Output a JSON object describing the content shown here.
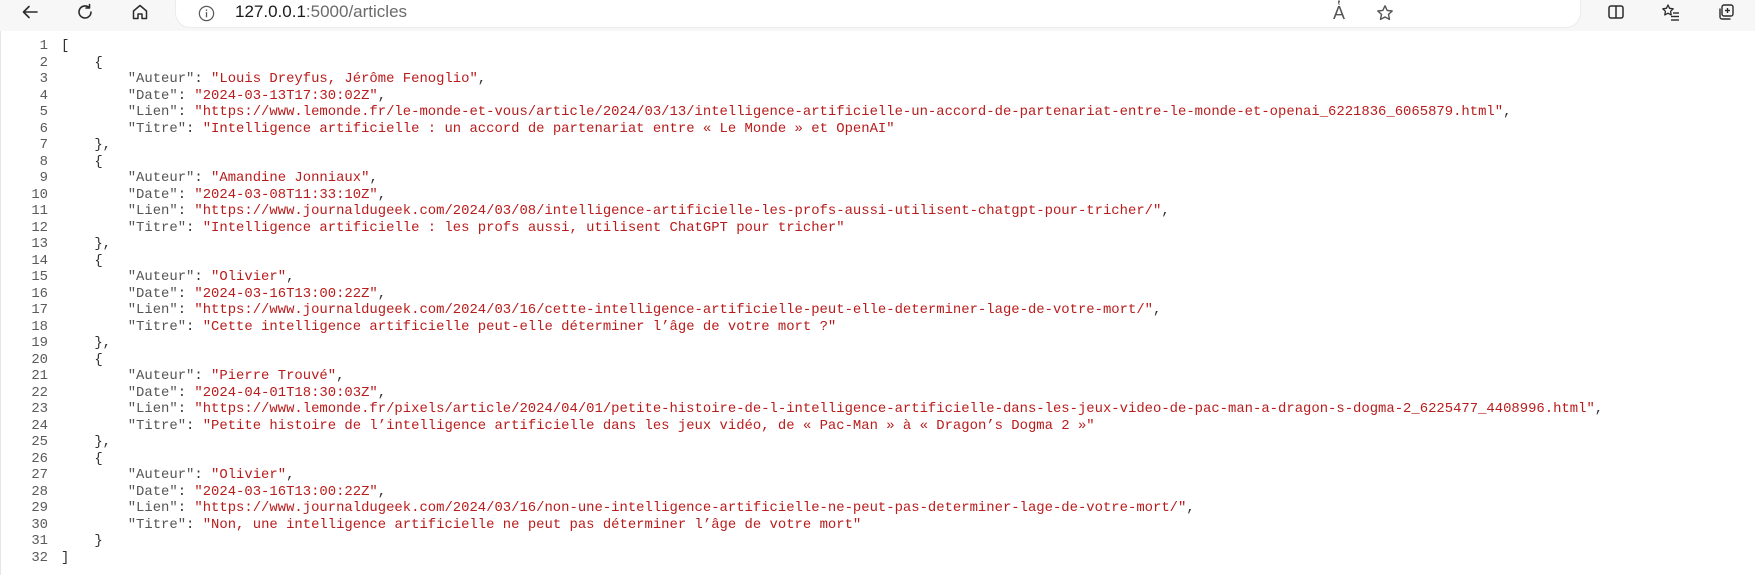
{
  "browser": {
    "url_host": "127.0.0.1",
    "url_path": ":5000/articles",
    "read_aloud_glyph": "A̔"
  },
  "json_lines": [
    "[",
    "    {",
    "        \"Auteur\": \"Louis Dreyfus, Jérôme Fenoglio\",",
    "        \"Date\": \"2024-03-13T17:30:02Z\",",
    "        \"Lien\": \"https://www.lemonde.fr/le-monde-et-vous/article/2024/03/13/intelligence-artificielle-un-accord-de-partenariat-entre-le-monde-et-openai_6221836_6065879.html\",",
    "        \"Titre\": \"Intelligence artificielle : un accord de partenariat entre « Le Monde » et OpenAI\"",
    "    },",
    "    {",
    "        \"Auteur\": \"Amandine Jonniaux\",",
    "        \"Date\": \"2024-03-08T11:33:10Z\",",
    "        \"Lien\": \"https://www.journaldugeek.com/2024/03/08/intelligence-artificielle-les-profs-aussi-utilisent-chatgpt-pour-tricher/\",",
    "        \"Titre\": \"Intelligence artificielle : les profs aussi, utilisent ChatGPT pour tricher\"",
    "    },",
    "    {",
    "        \"Auteur\": \"Olivier\",",
    "        \"Date\": \"2024-03-16T13:00:22Z\",",
    "        \"Lien\": \"https://www.journaldugeek.com/2024/03/16/cette-intelligence-artificielle-peut-elle-determiner-lage-de-votre-mort/\",",
    "        \"Titre\": \"Cette intelligence artificielle peut-elle déterminer l’âge de votre mort ?\"",
    "    },",
    "    {",
    "        \"Auteur\": \"Pierre Trouvé\",",
    "        \"Date\": \"2024-04-01T18:30:03Z\",",
    "        \"Lien\": \"https://www.lemonde.fr/pixels/article/2024/04/01/petite-histoire-de-l-intelligence-artificielle-dans-les-jeux-video-de-pac-man-a-dragon-s-dogma-2_6225477_4408996.html\",",
    "        \"Titre\": \"Petite histoire de l’intelligence artificielle dans les jeux vidéo, de « Pac-Man » à « Dragon’s Dogma 2 »\"",
    "    },",
    "    {",
    "        \"Auteur\": \"Olivier\",",
    "        \"Date\": \"2024-03-16T13:00:22Z\",",
    "        \"Lien\": \"https://www.journaldugeek.com/2024/03/16/non-une-intelligence-artificielle-ne-peut-pas-determiner-lage-de-votre-mort/\",",
    "        \"Titre\": \"Non, une intelligence artificielle ne peut pas déterminer l’âge de votre mort\"",
    "    }",
    "]"
  ],
  "colors": {
    "key": "#555555",
    "string": "#b91c1c",
    "punctuation": "#303030",
    "line_number": "#5a5a5a"
  }
}
